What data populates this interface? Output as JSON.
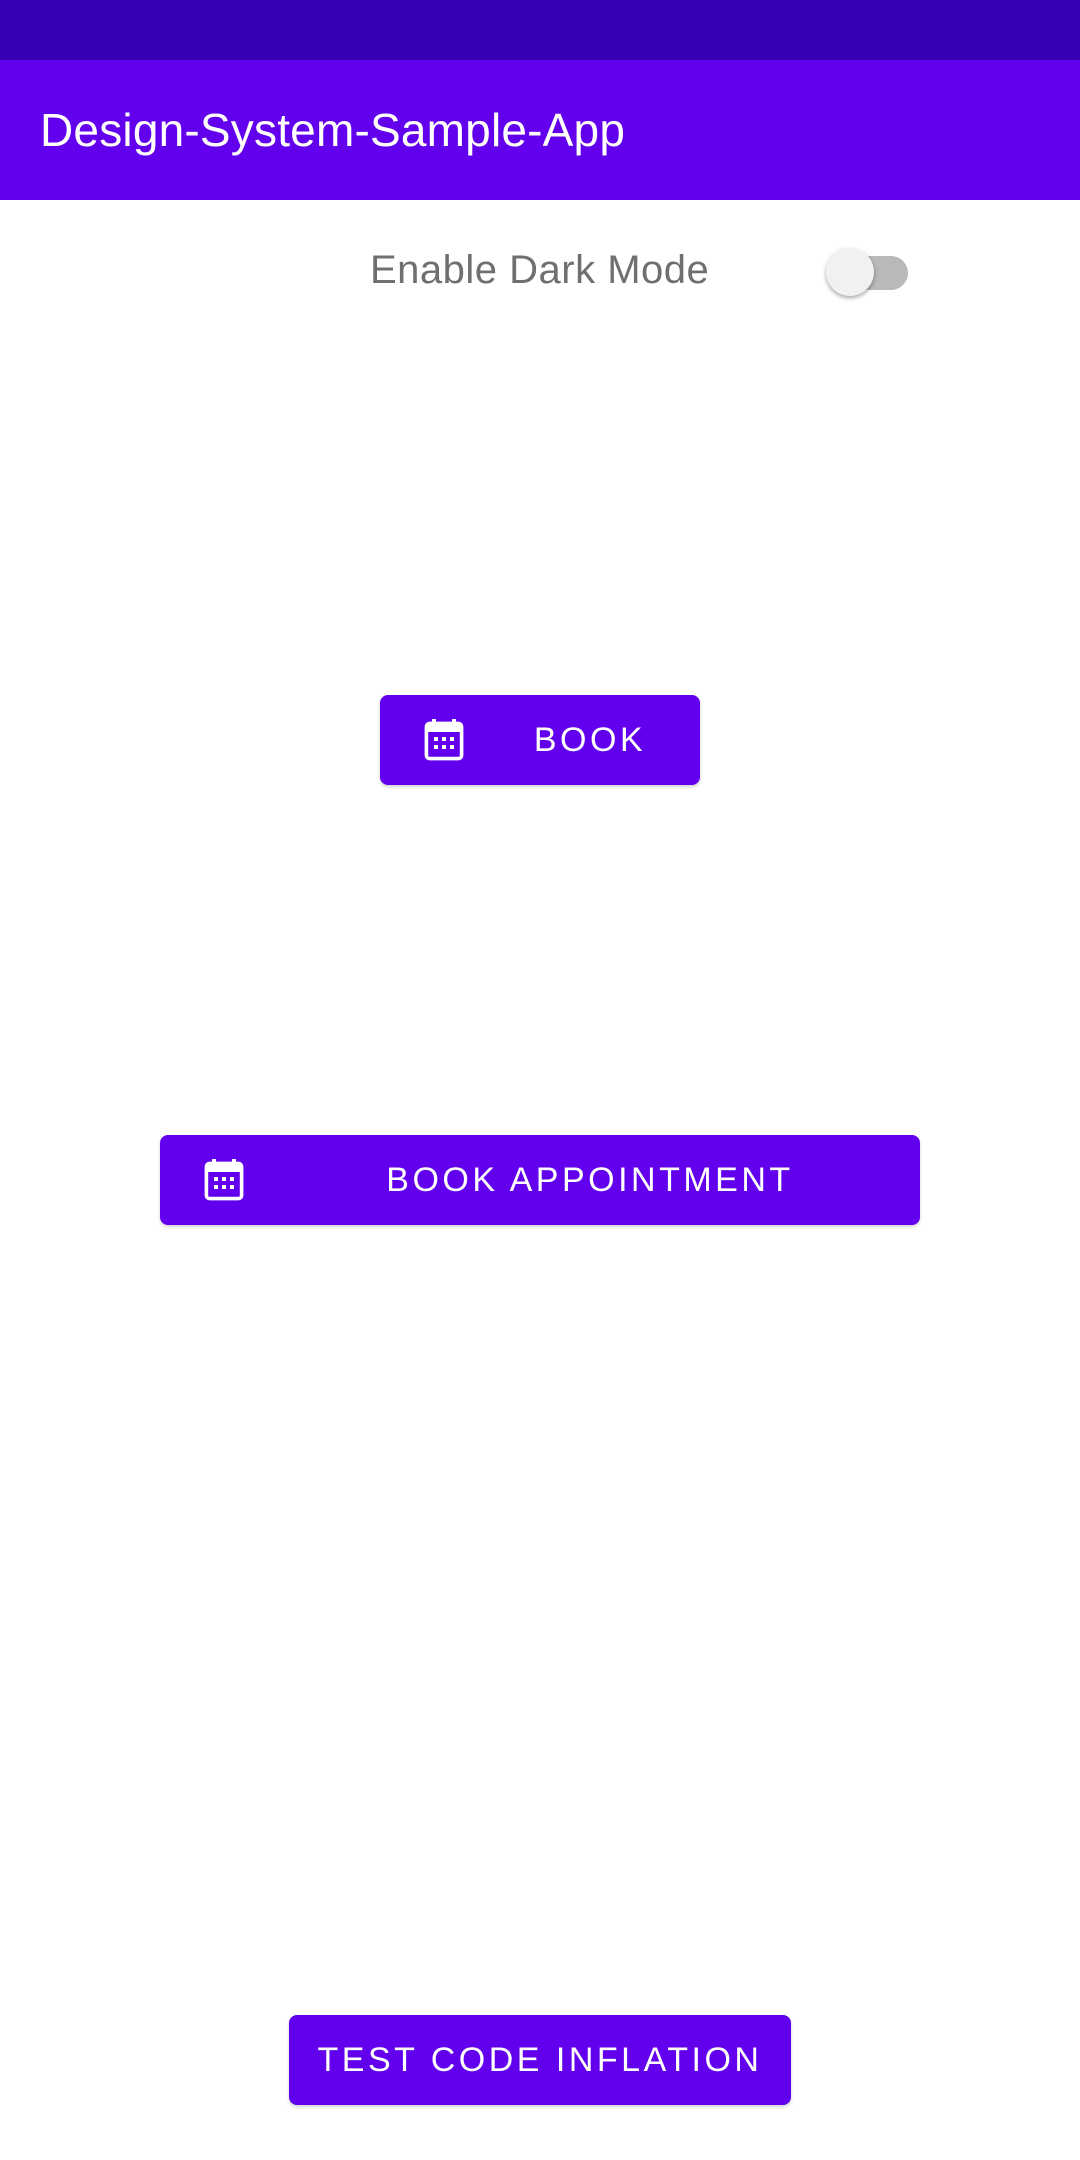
{
  "app_bar": {
    "title": "Design-System-Sample-App"
  },
  "settings": {
    "dark_mode_label": "Enable Dark Mode",
    "dark_mode_enabled": false
  },
  "buttons": {
    "book_label": "BOOK",
    "book_appointment_label": "BOOK APPOINTMENT",
    "test_code_inflation_label": "TEST CODE INFLATION",
    "icon": "calendar-icon"
  },
  "colors": {
    "primary": "#6200EE",
    "primary_dark": "#3700B3",
    "on_primary": "#FFFFFF",
    "label_text": "#6F6F6F"
  }
}
